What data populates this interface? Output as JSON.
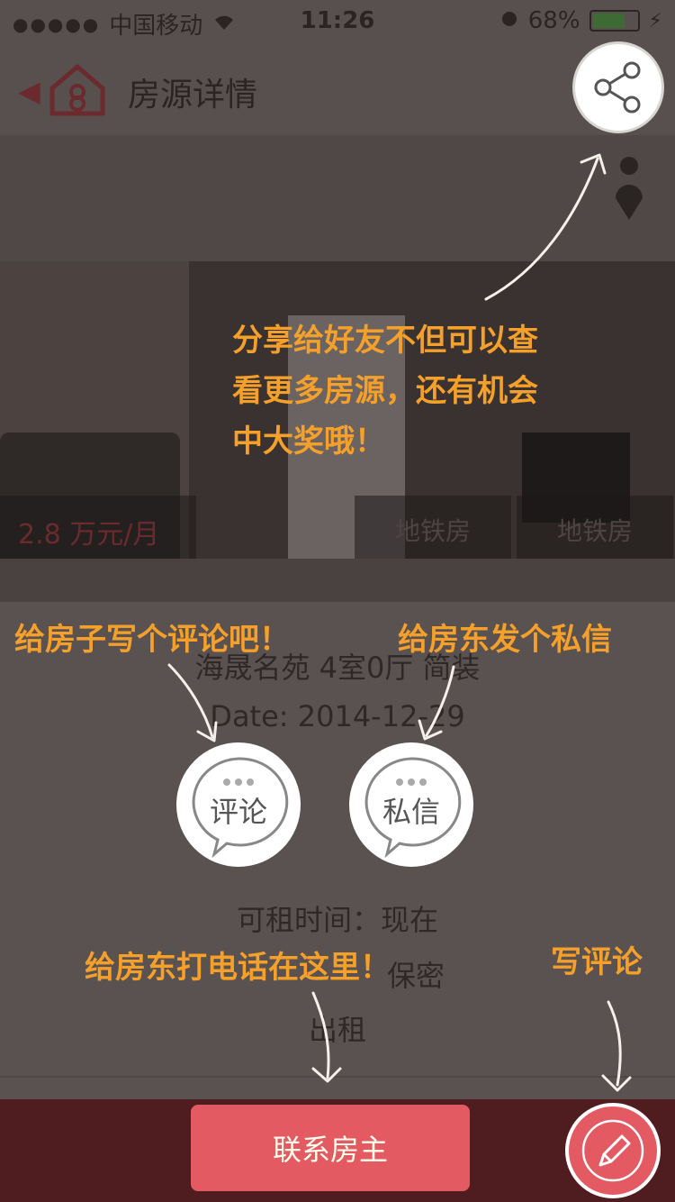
{
  "status_bar": {
    "signal": "●●●●●",
    "carrier": "中国移动",
    "time": "11:26",
    "battery": "68%"
  },
  "navbar": {
    "title": "房源详情"
  },
  "listing": {
    "price": "2.8 万元/月",
    "tags": [
      "地铁房",
      "地铁房"
    ],
    "name_line": "海晟名苑   4室0厅   简装",
    "date": "Date: 2014-12-29",
    "available": "可租时间：现在",
    "note_fragment": "保密",
    "rent_type": "出租"
  },
  "actions": {
    "comment_label": "评论",
    "message_label": "私信",
    "contact_label": "联系房主"
  },
  "hints": {
    "share": "分享给好友不但可以查看更多房源，还有机会中大奖哦！",
    "comment": "给房子写个评论吧！",
    "message": "给房东发个私信",
    "call": "给房东打电话在这里！",
    "write": "写评论"
  },
  "colors": {
    "overlay_bg": "#5a5250",
    "accent_red": "#e35a62",
    "hint_orange": "#f5a02a"
  }
}
